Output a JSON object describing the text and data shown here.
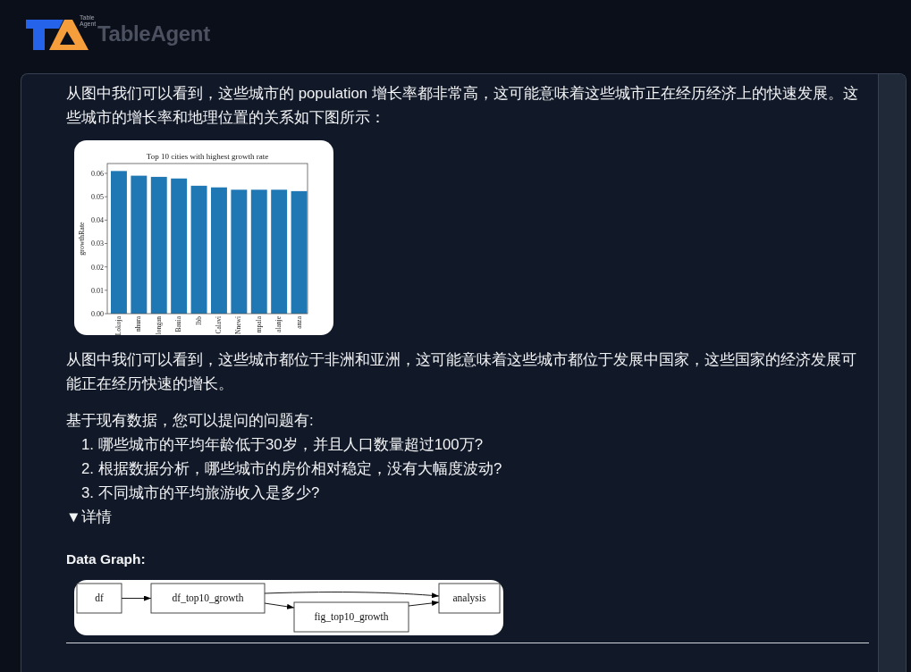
{
  "header": {
    "logo_small_text": "Table Agent",
    "brand": "TableAgent"
  },
  "message": {
    "paragraph_1": "从图中我们可以看到，这些城市的 population 增长率都非常高，这可能意味着这些城市正在经历经济上的快速发展。这些城市的增长率和地理位置的关系如下图所示：",
    "chart_data": {
      "type": "bar",
      "title": "Top 10 cities with highest growth rate",
      "ylabel": "growthRate",
      "categories": [
        "Lokoja",
        "nhura",
        "longan",
        "Bauia",
        "Ibb",
        "Calavi",
        "Nnewi",
        "mpala",
        "alanje",
        "anza"
      ],
      "values": [
        0.061,
        0.059,
        0.0585,
        0.0578,
        0.0547,
        0.054,
        0.053,
        0.053,
        0.053,
        0.0524
      ],
      "ylim": [
        0,
        0.0642
      ],
      "yticks": [
        {
          "value": 0,
          "label": "0.00"
        },
        {
          "value": 0.01,
          "label": "0.01"
        },
        {
          "value": 0.02,
          "label": "0.02"
        },
        {
          "value": 0.03,
          "label": "0.03"
        },
        {
          "value": 0.04,
          "label": "0.04"
        },
        {
          "value": 0.05,
          "label": "0.05"
        },
        {
          "value": 0.06,
          "label": "0.06"
        }
      ]
    },
    "paragraph_2": "从图中我们可以看到，这些城市都位于非洲和亚洲，这可能意味着这些城市都位于发展中国家，这些国家的经济发展可能正在经历快速的增长。",
    "questions_intro": "基于现有数据，您可以提问的问题有:",
    "questions": [
      {
        "number": "1.",
        "text": "哪些城市的平均年龄低于30岁，并且人口数量超过100万?"
      },
      {
        "number": "2.",
        "text": "根据数据分析，哪些城市的房价相对稳定，没有大幅度波动?"
      },
      {
        "number": "3.",
        "text": "不同城市的平均旅游收入是多少?"
      }
    ],
    "details": {
      "marker": "▼",
      "label": "详情"
    },
    "graph_heading": "Data Graph:",
    "graph_nodes": [
      {
        "label": "df"
      },
      {
        "label": "df_top10_growth"
      },
      {
        "label": "fig_top10_growth"
      },
      {
        "label": "analysis"
      }
    ]
  }
}
